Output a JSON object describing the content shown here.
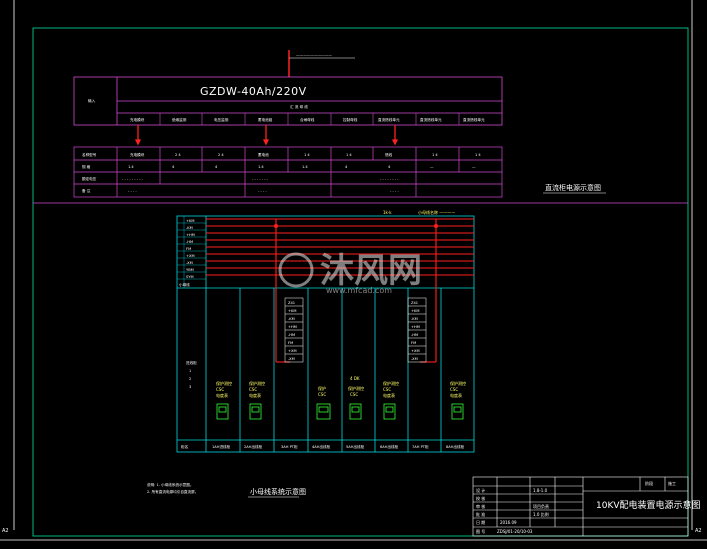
{
  "colors": {
    "frame": "#ffffff",
    "border": "#00e5a0",
    "magenta": "#d24bd2",
    "cyan": "#00d8e0",
    "red": "#ff2020",
    "green": "#33ff33",
    "yellow": "#ffff66"
  },
  "dc_system": {
    "model_label": "GZDW-40Ah/220V",
    "title": "直流柜电源示意图",
    "row_labels": [
      "",
      "",
      "",
      ""
    ],
    "columns": [
      "",
      "",
      "",
      "",
      "",
      "",
      "",
      "",
      "",
      ""
    ]
  },
  "panel_diagram": {
    "title": "小母线系统示意图",
    "top_label": "1k-k"
  },
  "title_block": {
    "drawing_title": "10KV配电装置电源示意图",
    "stamp_text": "",
    "side_labels": [
      "",
      ""
    ]
  },
  "watermark": {
    "brand": "沐风网",
    "url": "www.mfcad.com"
  },
  "corner_labels": {
    "left": "A2",
    "right": "A2"
  }
}
